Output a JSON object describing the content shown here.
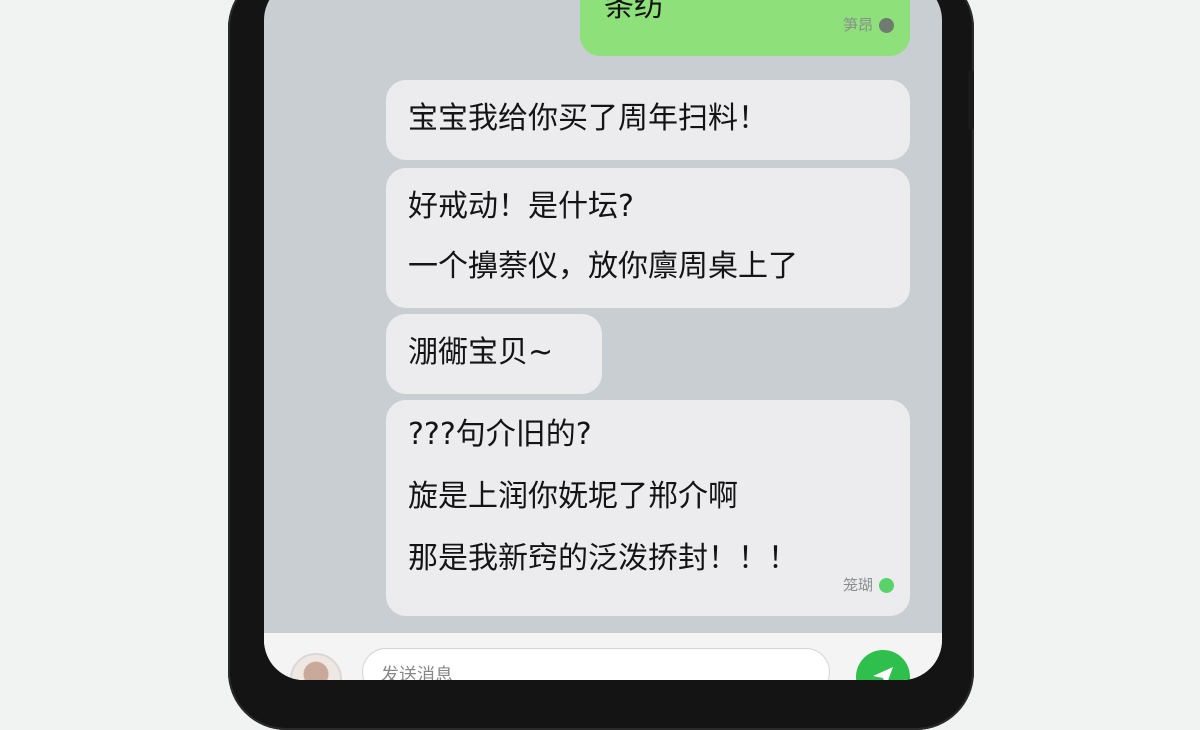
{
  "conversation": {
    "messages": [
      {
        "direction": "outgoing",
        "lines": [
          "条纺"
        ],
        "status": "笋昂"
      },
      {
        "direction": "incoming",
        "lines": [
          "宝宝我给你买了周年扫料！"
        ]
      },
      {
        "direction": "incoming",
        "lines": [
          "好戒动！是什坛?",
          "一个擤萘仪，放你廪周桌上了"
        ]
      },
      {
        "direction": "incoming",
        "lines": [
          "淜衚宝贝~"
        ]
      },
      {
        "direction": "incoming",
        "lines": [
          "???句介旧的?",
          "旋是上润你妩坭了郱介啊",
          "那是我新窍的泛泼挢封！！！"
        ],
        "status": "笼瑚"
      }
    ]
  },
  "composer": {
    "placeholder": "发送消息",
    "send_icon": "send-icon"
  },
  "colors": {
    "outgoing_bubble": "#8de07a",
    "incoming_bubble": "#ececef",
    "send_button": "#2fbf4c",
    "online_dot": "#58d269"
  }
}
